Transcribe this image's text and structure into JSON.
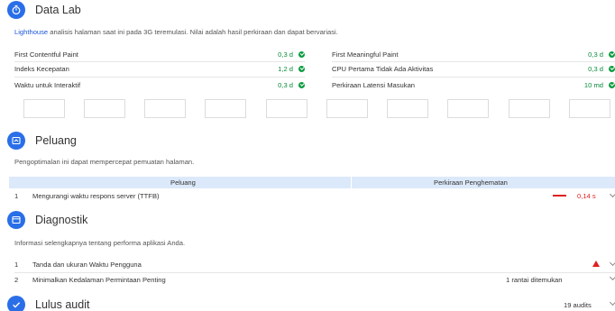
{
  "data_lab": {
    "title": "Data Lab",
    "desc_link": "Lighthouse",
    "desc_rest": " analisis halaman saat ini pada 3G teremulasi. Nilai adalah hasil perkiraan dan dapat bervariasi.",
    "metrics_left": [
      {
        "label": "First Contentful Paint",
        "value": "0,3 d"
      },
      {
        "label": "Indeks Kecepatan",
        "value": "1,2 d"
      },
      {
        "label": "Waktu untuk Interaktif",
        "value": "0,3 d"
      }
    ],
    "metrics_right": [
      {
        "label": "First Meaningful Paint",
        "value": "0,3 d"
      },
      {
        "label": "CPU Pertama Tidak Ada Aktivitas",
        "value": "0,3 d"
      },
      {
        "label": "Perkiraan Latensi Masukan",
        "value": "10 md"
      }
    ]
  },
  "peluang": {
    "title": "Peluang",
    "desc": "Pengoptimalan ini dapat mempercepat pemuatan halaman.",
    "col1": "Peluang",
    "col2": "Perkiraan Penghematan",
    "rows": [
      {
        "num": "1",
        "label": "Mengurangi waktu respons server (TTFB)",
        "value": "0,14 s"
      }
    ]
  },
  "diagnostik": {
    "title": "Diagnostik",
    "desc": "Informasi selengkapnya tentang performa aplikasi Anda.",
    "rows": [
      {
        "num": "1",
        "label": "Tanda dan ukuran Waktu Pengguna",
        "value": ""
      },
      {
        "num": "2",
        "label": "Minimalkan Kedalaman Permintaan Penting",
        "value": "1 rantai ditemukan"
      }
    ]
  },
  "lulus": {
    "title": "Lulus audit",
    "count": "19 audits"
  },
  "colors": {
    "accent": "#2a6ee8",
    "pass": "#0c9d41",
    "fail": "#e02020",
    "table_header": "#dbe9fb"
  }
}
